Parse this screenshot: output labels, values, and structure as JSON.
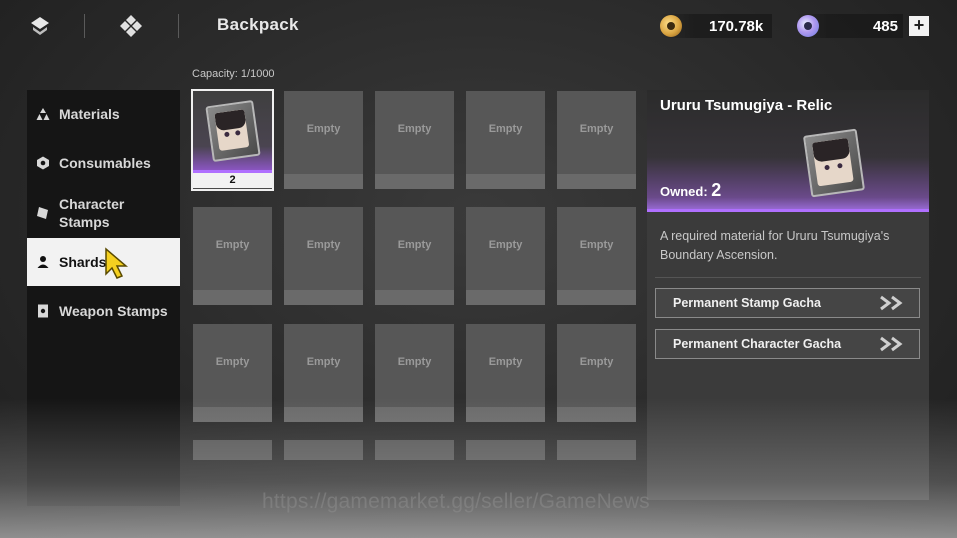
{
  "header": {
    "title": "Backpack",
    "gold_amount": "170.78k",
    "gem_amount": "485",
    "add_label": "+"
  },
  "inventory": {
    "capacity_text": "Capacity: 1/1000",
    "empty_label": "Empty",
    "selected_count": "2"
  },
  "sidebar": {
    "items": [
      {
        "label": "Materials",
        "icon": "triangle-cluster-icon"
      },
      {
        "label": "Consumables",
        "icon": "hexagon-icon"
      },
      {
        "label": "Character Stamps",
        "icon": "stamp-icon"
      },
      {
        "label": "Shards",
        "icon": "person-icon",
        "active": true
      },
      {
        "label": "Weapon Stamps",
        "icon": "card-icon"
      }
    ]
  },
  "detail": {
    "title": "Ururu Tsumugiya - Relic",
    "owned_label": "Owned:",
    "owned_value": "2",
    "description": "A required material for Ururu Tsumugiya's Boundary Ascension.",
    "buttons": [
      {
        "label": "Permanent Stamp Gacha"
      },
      {
        "label": "Permanent Character Gacha"
      }
    ]
  },
  "watermark": "https://gamemarket.gg/seller/GameNews",
  "colors": {
    "accent_purple": "#b070ff",
    "active_tab_bg": "#f2f2f2"
  }
}
